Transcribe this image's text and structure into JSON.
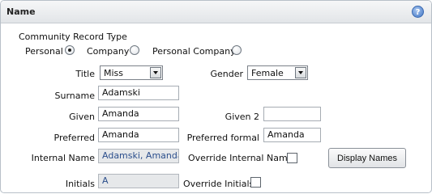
{
  "panel": {
    "title": "Name",
    "help_icon": "?"
  },
  "record_type": {
    "label": "Community Record Type",
    "options": [
      {
        "label": "Personal",
        "selected": true
      },
      {
        "label": "Company",
        "selected": false
      },
      {
        "label": "Personal Company",
        "selected": false
      }
    ]
  },
  "fields": {
    "title": {
      "label": "Title",
      "value": "Miss"
    },
    "gender": {
      "label": "Gender",
      "value": "Female"
    },
    "surname": {
      "label": "Surname",
      "value": "Adamski"
    },
    "given": {
      "label": "Given",
      "value": "Amanda"
    },
    "given2": {
      "label": "Given 2",
      "value": ""
    },
    "preferred": {
      "label": "Preferred",
      "value": "Amanda"
    },
    "preferred_formal": {
      "label": "Preferred formal",
      "value": "Amanda"
    },
    "internal_name": {
      "label": "Internal Name",
      "value": "Adamski, Amanda"
    },
    "override_internal_name": {
      "label": "Override Internal Name",
      "checked": false
    },
    "initials": {
      "label": "Initials",
      "value": "A"
    },
    "override_initials": {
      "label": "Override Initials",
      "checked": false
    }
  },
  "buttons": {
    "display_names": "Display Names"
  }
}
